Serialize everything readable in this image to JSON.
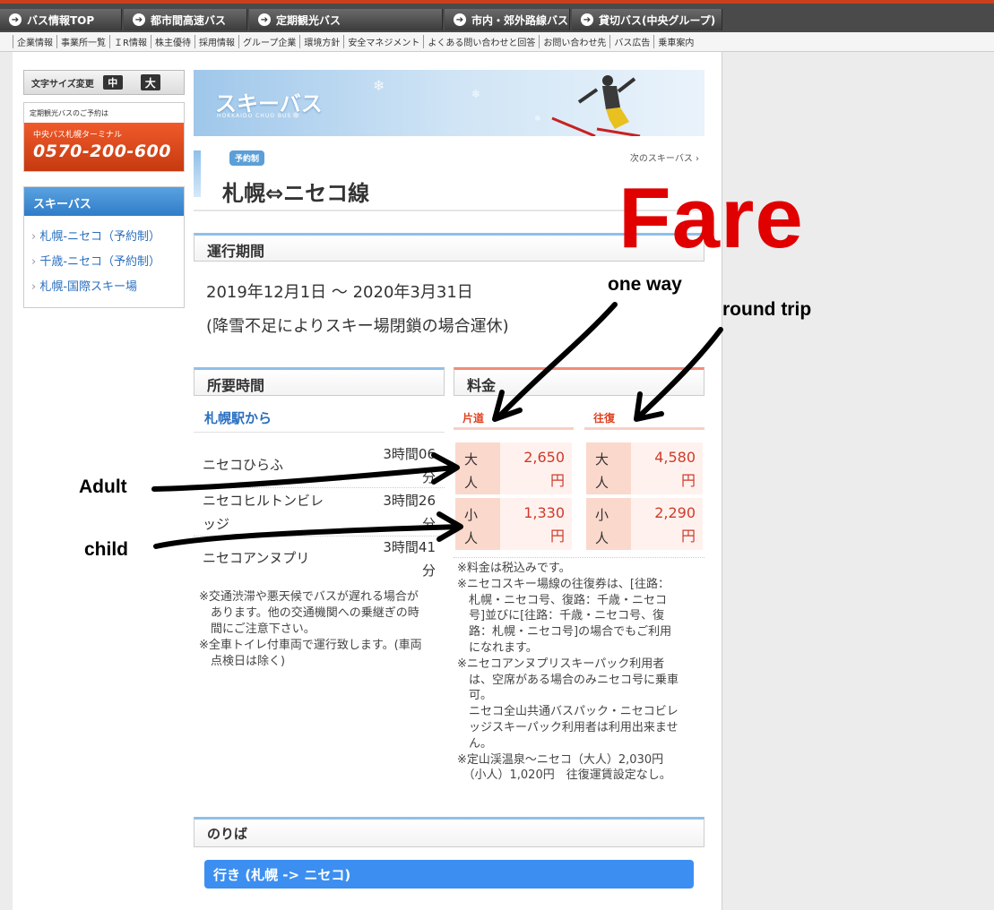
{
  "topnav": {
    "tabs": [
      "バス情報TOP",
      "都市間高速バス",
      "定期観光バス",
      "市内・郊外路線バス",
      "貸切バス(中央グループ)"
    ],
    "tab_icon": "circle-arrow-icon"
  },
  "subnav": {
    "links": [
      "企業情報",
      "事業所一覧",
      "ＩR情報",
      "株主優待",
      "採用情報",
      "グループ企業",
      "環境方針",
      "安全マネジメント",
      "よくある問い合わせと回答",
      "お問い合わせ先",
      "バス広告",
      "乗車案内"
    ]
  },
  "sidebar": {
    "font_size_label": "文字サイズ変更",
    "font_medium": "中",
    "font_large": "大",
    "reserve_label": "定期観光バスのご予約は",
    "terminal_name": "中央バス札幌ターミナル",
    "phone": "0570-200-600",
    "ski_menu_title": "スキーバス",
    "ski_links": [
      "札幌-ニセコ（予約制）",
      "千歳-ニセコ（予約制）",
      "札幌-国際スキー場"
    ]
  },
  "banner": {
    "title": "スキーバス",
    "subtitle": "HOKKAIDO CHUO BUS"
  },
  "route": {
    "badge": "予約制",
    "name": "札幌⇔ニセコ線",
    "next_link": "次のスキーバス ›"
  },
  "period": {
    "heading": "運行期間",
    "dates": "2019年12月1日 〜 2020年3月31日",
    "note": "(降雪不足によりスキー場閉鎖の場合運休)"
  },
  "duration": {
    "heading": "所要時間",
    "from_label": "札幌駅から",
    "stops": [
      {
        "name": "ニセコひらふ",
        "time_line1": "3時間06",
        "time_line2": "分"
      },
      {
        "name_line1": "ニセコヒルトンビレ",
        "name_line2": "ッジ",
        "time_line1": "3時間26",
        "time_line2": "分"
      },
      {
        "name": "ニセコアンヌプリ",
        "time_line1": "3時間41",
        "time_line2": "分"
      }
    ],
    "notes": [
      "※交通渋滞や悪天候でバスが遅れる場合が",
      "　あります。他の交通機関への乗継ぎの時",
      "　間にご注意下さい。",
      "※全車トイレ付車両で運行致します。(車両",
      "　点検日は除く)"
    ]
  },
  "fare": {
    "heading": "料金",
    "one_way_label": "片道",
    "round_trip_label": "往復",
    "adult_l1": "大",
    "adult_l2": "人",
    "child_l1": "小",
    "child_l2": "人",
    "yen": "円",
    "one_way_adult": "2,650",
    "one_way_child": "1,330",
    "round_adult": "4,580",
    "round_child": "2,290",
    "notes": [
      "※料金は税込みです。",
      "※ニセコスキー場線の往復券は、[往路：",
      "　札幌・ニセコ号、復路：千歳・ニセコ",
      "　号]並びに[往路：千歳・ニセコ号、復",
      "　路：札幌・ニセコ号]の場合でもご利用",
      "　になれます。",
      "※ニセコアンヌプリスキーパック利用者",
      "　は、空席がある場合のみニセコ号に乗車",
      "　可。",
      "　ニセコ全山共通バスパック・ニセコビレ",
      "　ッジスキーパック利用者は利用出来ませ",
      "　ん。",
      "※定山渓温泉〜ニセコ（大人）2,030円",
      "　（小人）1,020円　往復運賃設定なし。"
    ]
  },
  "boarding": {
    "heading": "のりば",
    "direction_button": "行き (札幌 -> ニセコ)"
  },
  "annotations": {
    "fare": "Fare",
    "one_way": "one way",
    "round_trip": "round trip",
    "adult": "Adult",
    "child": "child",
    "fare_color": "#e00000"
  }
}
